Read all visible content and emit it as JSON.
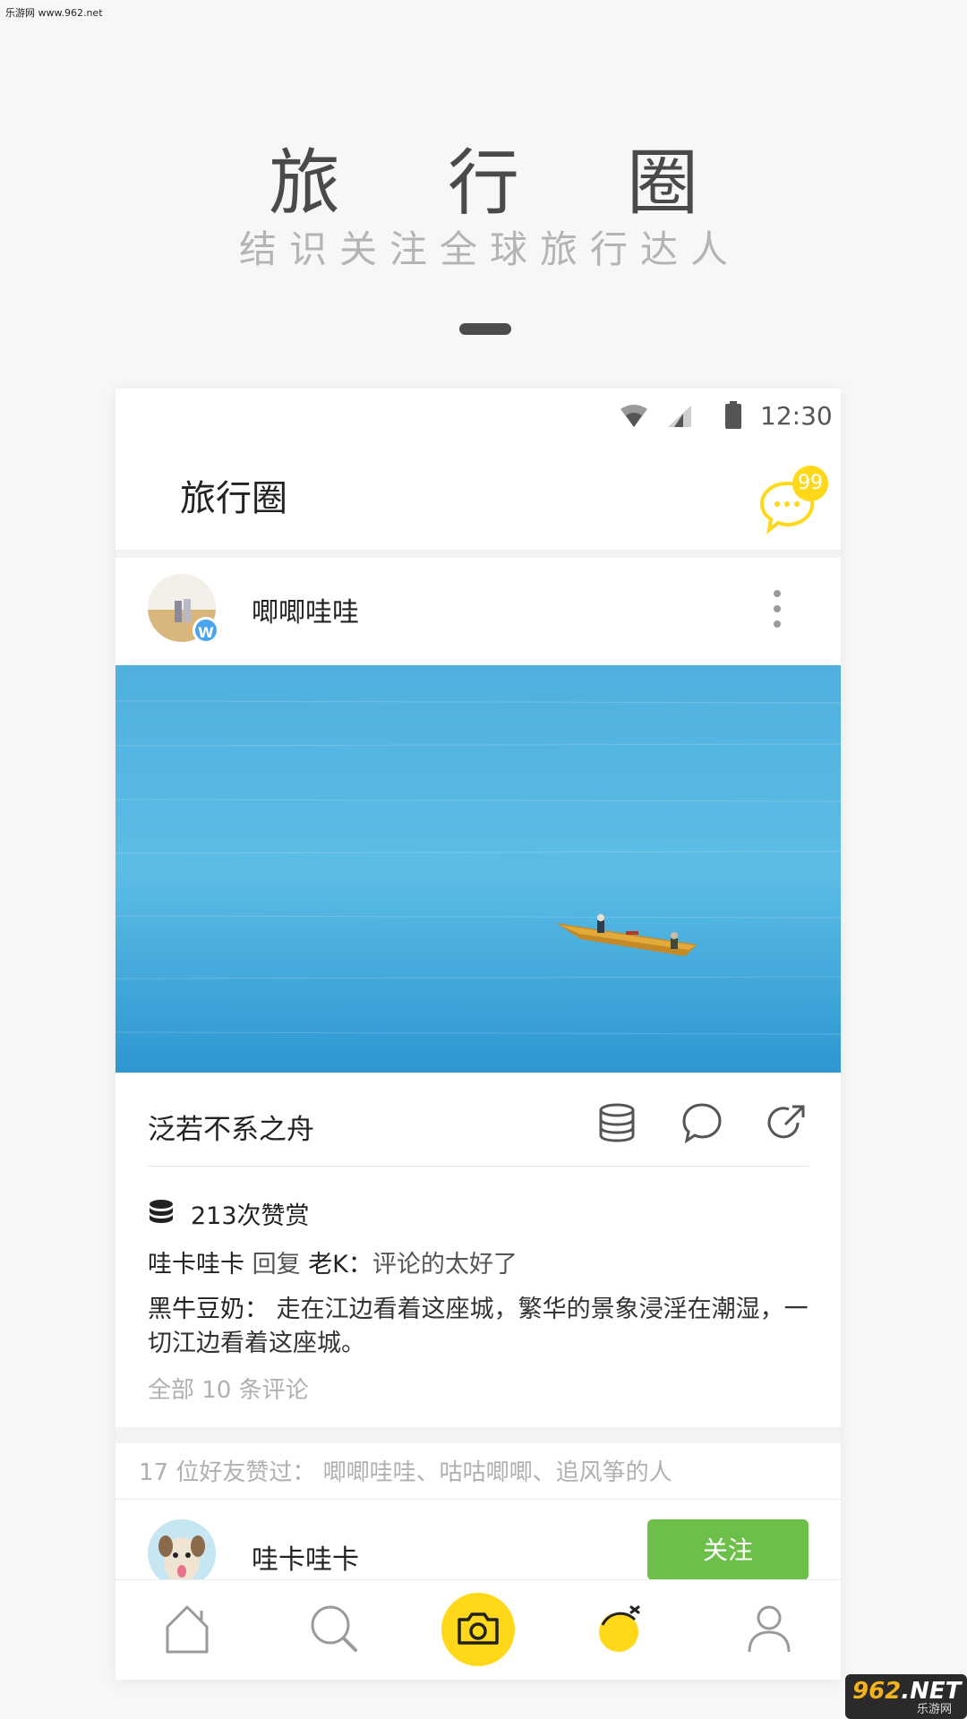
{
  "watermark_top": "乐游网 www.962.net",
  "hero": {
    "title": "旅行圈",
    "subtitle": "结识关注全球旅行达人"
  },
  "statusbar": {
    "time": "12:30"
  },
  "appbar": {
    "title": "旅行圈",
    "message_badge": "99"
  },
  "post": {
    "username": "唧唧哇哇",
    "verified_label": "W",
    "caption": "泛若不系之舟",
    "likes_count_text": "213次赞赏",
    "comments": [
      {
        "author": "哇卡哇卡",
        "reply_word": "回复",
        "reply_to": "老K：",
        "text": "评论的太好了"
      },
      {
        "author": "黑牛豆奶：",
        "text": "走在江边看着这座城，繁华的景象浸淫在潮湿，一切江边看着这座城。"
      }
    ],
    "all_comments": "全部 10 条评论"
  },
  "friends_liked": {
    "text": "17 位好友赞过：",
    "names": "唧唧哇哇、咕咕唧唧、追风筝的人"
  },
  "suggested_user": {
    "name": "哇卡哇卡",
    "follow_label": "关注"
  },
  "watermark_bottom": {
    "brand_a": "962",
    "brand_b": ".NET",
    "cn": "乐游网"
  },
  "icons": [
    "wifi-icon",
    "signal-icon",
    "battery-icon",
    "message-icon",
    "more-icon",
    "collect-icon",
    "comment-icon",
    "share-icon",
    "coin-icon",
    "home-icon",
    "search-icon",
    "camera-icon",
    "discover-icon",
    "profile-icon"
  ],
  "colors": {
    "accent": "#ffd81a",
    "follow": "#6cc04a",
    "verified": "#49a6ee"
  }
}
